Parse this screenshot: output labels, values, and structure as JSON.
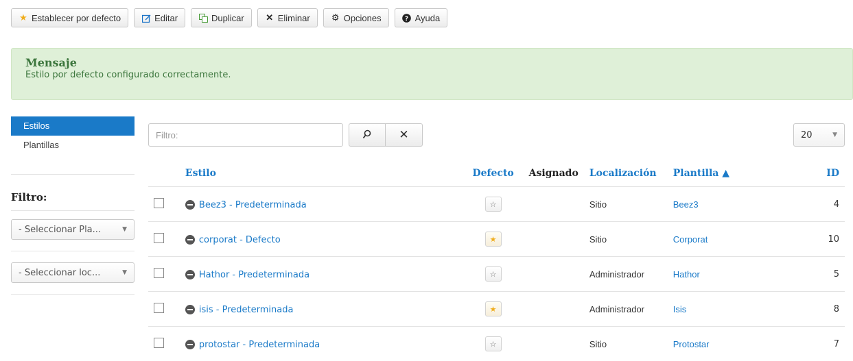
{
  "toolbar": {
    "set_default": "Establecer por defecto",
    "edit": "Editar",
    "duplicate": "Duplicar",
    "delete": "Eliminar",
    "options": "Opciones",
    "help": "Ayuda"
  },
  "message": {
    "title": "Mensaje",
    "text": "Estilo por defecto configurado correctamente."
  },
  "sidebar": {
    "items": [
      {
        "label": "Estilos",
        "active": true
      },
      {
        "label": "Plantillas",
        "active": false
      }
    ],
    "filter_title": "Filtro:",
    "select_template": "- Seleccionar Pla...",
    "select_location": "- Seleccionar loc..."
  },
  "search": {
    "placeholder": "Filtro:"
  },
  "limit": {
    "value": "20"
  },
  "table": {
    "headers": {
      "style": "Estilo",
      "default": "Defecto",
      "assigned": "Asignado",
      "location": "Localización",
      "template": "Plantilla ▲",
      "id": "ID"
    },
    "rows": [
      {
        "style": "Beez3 - Predeterminada",
        "is_default": false,
        "location": "Sitio",
        "template": "Beez3",
        "id": "4"
      },
      {
        "style": "corporat - Defecto",
        "is_default": true,
        "location": "Sitio",
        "template": "Corporat",
        "id": "10"
      },
      {
        "style": "Hathor - Predeterminada",
        "is_default": false,
        "location": "Administrador",
        "template": "Hathor",
        "id": "5"
      },
      {
        "style": "isis - Predeterminada",
        "is_default": true,
        "location": "Administrador",
        "template": "Isis",
        "id": "8"
      },
      {
        "style": "protostar - Predeterminada",
        "is_default": false,
        "location": "Sitio",
        "template": "Protostar",
        "id": "7"
      }
    ]
  },
  "colors": {
    "accent": "#1a7ac8",
    "success_bg": "#dff0d8",
    "success_text": "#3c763d",
    "star": "#f0ad1c"
  }
}
